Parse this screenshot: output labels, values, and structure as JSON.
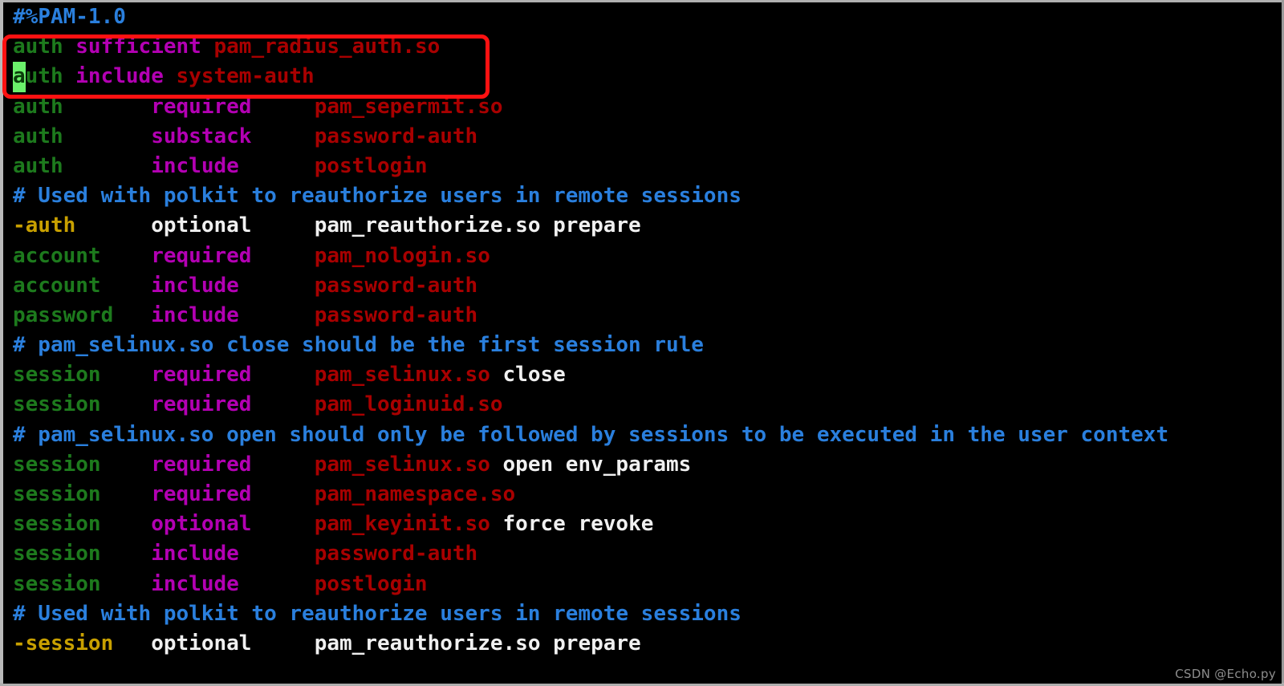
{
  "app": {
    "title": "PAM configuration file (/etc/pam.d/sshd) open in terminal editor",
    "background_color": "#000000"
  },
  "colors": {
    "comment": "#2a7fdd",
    "type": "#1d7a1d",
    "negated_type": "#c8a000",
    "control_flag": "#b300b3",
    "module": "#a80000",
    "argument": "#f0f0f0",
    "cursor_background": "#6bf06b",
    "cursor_foreground": "#0b3d0b",
    "annotation_rectangle": "#ff1111"
  },
  "cursor": {
    "character": "a",
    "line_index": 2,
    "column": 1
  },
  "annotation": {
    "shape": "rectangle",
    "color": "#ff1111",
    "covers_lines": [
      "auth sufficient pam_radius_auth.so",
      "auth include system-auth"
    ]
  },
  "watermark": {
    "text": "CSDN @Echo.py"
  },
  "lines": [
    {
      "id": "line-1",
      "tokens": [
        {
          "text": "#%PAM-1.0",
          "kind": "comment"
        }
      ]
    },
    {
      "id": "line-2",
      "tokens": [
        {
          "text": "auth",
          "kind": "type"
        },
        {
          "text": " ",
          "kind": "plain"
        },
        {
          "text": "sufficient",
          "kind": "ctrl"
        },
        {
          "text": " ",
          "kind": "plain"
        },
        {
          "text": "pam_radius_auth.so",
          "kind": "module"
        }
      ]
    },
    {
      "id": "line-3",
      "tokens": [
        {
          "text": "a",
          "kind": "cursor"
        },
        {
          "text": "uth",
          "kind": "type"
        },
        {
          "text": " ",
          "kind": "plain"
        },
        {
          "text": "include",
          "kind": "ctrl"
        },
        {
          "text": " ",
          "kind": "plain"
        },
        {
          "text": "system-auth",
          "kind": "module"
        }
      ]
    },
    {
      "id": "line-4",
      "tokens": [
        {
          "text": "auth",
          "kind": "type"
        },
        {
          "text": "       ",
          "kind": "plain"
        },
        {
          "text": "required",
          "kind": "ctrl"
        },
        {
          "text": "     ",
          "kind": "plain"
        },
        {
          "text": "pam_sepermit.so",
          "kind": "module"
        }
      ]
    },
    {
      "id": "line-5",
      "tokens": [
        {
          "text": "auth",
          "kind": "type"
        },
        {
          "text": "       ",
          "kind": "plain"
        },
        {
          "text": "substack",
          "kind": "ctrl"
        },
        {
          "text": "     ",
          "kind": "plain"
        },
        {
          "text": "password-auth",
          "kind": "module"
        }
      ]
    },
    {
      "id": "line-6",
      "tokens": [
        {
          "text": "auth",
          "kind": "type"
        },
        {
          "text": "       ",
          "kind": "plain"
        },
        {
          "text": "include",
          "kind": "ctrl"
        },
        {
          "text": "      ",
          "kind": "plain"
        },
        {
          "text": "postlogin",
          "kind": "module"
        }
      ]
    },
    {
      "id": "line-7",
      "tokens": [
        {
          "text": "# Used with polkit to reauthorize users in remote sessions",
          "kind": "comment"
        }
      ]
    },
    {
      "id": "line-8",
      "tokens": [
        {
          "text": "-auth",
          "kind": "neg"
        },
        {
          "text": "      ",
          "kind": "plain"
        },
        {
          "text": "optional",
          "kind": "arg"
        },
        {
          "text": "     ",
          "kind": "plain"
        },
        {
          "text": "pam_reauthorize.so prepare",
          "kind": "arg"
        }
      ]
    },
    {
      "id": "line-9",
      "tokens": [
        {
          "text": "account",
          "kind": "type"
        },
        {
          "text": "    ",
          "kind": "plain"
        },
        {
          "text": "required",
          "kind": "ctrl"
        },
        {
          "text": "     ",
          "kind": "plain"
        },
        {
          "text": "pam_nologin.so",
          "kind": "module"
        }
      ]
    },
    {
      "id": "line-10",
      "tokens": [
        {
          "text": "account",
          "kind": "type"
        },
        {
          "text": "    ",
          "kind": "plain"
        },
        {
          "text": "include",
          "kind": "ctrl"
        },
        {
          "text": "      ",
          "kind": "plain"
        },
        {
          "text": "password-auth",
          "kind": "module"
        }
      ]
    },
    {
      "id": "line-11",
      "tokens": [
        {
          "text": "password",
          "kind": "type"
        },
        {
          "text": "   ",
          "kind": "plain"
        },
        {
          "text": "include",
          "kind": "ctrl"
        },
        {
          "text": "      ",
          "kind": "plain"
        },
        {
          "text": "password-auth",
          "kind": "module"
        }
      ]
    },
    {
      "id": "line-12",
      "tokens": [
        {
          "text": "# pam_selinux.so close should be the first session rule",
          "kind": "comment"
        }
      ]
    },
    {
      "id": "line-13",
      "tokens": [
        {
          "text": "session",
          "kind": "type"
        },
        {
          "text": "    ",
          "kind": "plain"
        },
        {
          "text": "required",
          "kind": "ctrl"
        },
        {
          "text": "     ",
          "kind": "plain"
        },
        {
          "text": "pam_selinux.so",
          "kind": "module"
        },
        {
          "text": " ",
          "kind": "plain"
        },
        {
          "text": "close",
          "kind": "arg"
        }
      ]
    },
    {
      "id": "line-14",
      "tokens": [
        {
          "text": "session",
          "kind": "type"
        },
        {
          "text": "    ",
          "kind": "plain"
        },
        {
          "text": "required",
          "kind": "ctrl"
        },
        {
          "text": "     ",
          "kind": "plain"
        },
        {
          "text": "pam_loginuid.so",
          "kind": "module"
        }
      ]
    },
    {
      "id": "line-15",
      "tokens": [
        {
          "text": "# pam_selinux.so open should only be followed by sessions to be executed in the user context",
          "kind": "comment"
        }
      ]
    },
    {
      "id": "line-16",
      "tokens": [
        {
          "text": "session",
          "kind": "type"
        },
        {
          "text": "    ",
          "kind": "plain"
        },
        {
          "text": "required",
          "kind": "ctrl"
        },
        {
          "text": "     ",
          "kind": "plain"
        },
        {
          "text": "pam_selinux.so",
          "kind": "module"
        },
        {
          "text": " ",
          "kind": "plain"
        },
        {
          "text": "open env_params",
          "kind": "arg"
        }
      ]
    },
    {
      "id": "line-17",
      "tokens": [
        {
          "text": "session",
          "kind": "type"
        },
        {
          "text": "    ",
          "kind": "plain"
        },
        {
          "text": "required",
          "kind": "ctrl"
        },
        {
          "text": "     ",
          "kind": "plain"
        },
        {
          "text": "pam_namespace.so",
          "kind": "module"
        }
      ]
    },
    {
      "id": "line-18",
      "tokens": [
        {
          "text": "session",
          "kind": "type"
        },
        {
          "text": "    ",
          "kind": "plain"
        },
        {
          "text": "optional",
          "kind": "ctrl"
        },
        {
          "text": "     ",
          "kind": "plain"
        },
        {
          "text": "pam_keyinit.so",
          "kind": "module"
        },
        {
          "text": " ",
          "kind": "plain"
        },
        {
          "text": "force revoke",
          "kind": "arg"
        }
      ]
    },
    {
      "id": "line-19",
      "tokens": [
        {
          "text": "session",
          "kind": "type"
        },
        {
          "text": "    ",
          "kind": "plain"
        },
        {
          "text": "include",
          "kind": "ctrl"
        },
        {
          "text": "      ",
          "kind": "plain"
        },
        {
          "text": "password-auth",
          "kind": "module"
        }
      ]
    },
    {
      "id": "line-20",
      "tokens": [
        {
          "text": "session",
          "kind": "type"
        },
        {
          "text": "    ",
          "kind": "plain"
        },
        {
          "text": "include",
          "kind": "ctrl"
        },
        {
          "text": "      ",
          "kind": "plain"
        },
        {
          "text": "postlogin",
          "kind": "module"
        }
      ]
    },
    {
      "id": "line-21",
      "tokens": [
        {
          "text": "# Used with polkit to reauthorize users in remote sessions",
          "kind": "comment"
        }
      ]
    },
    {
      "id": "line-22",
      "tokens": [
        {
          "text": "-session",
          "kind": "neg"
        },
        {
          "text": "   ",
          "kind": "plain"
        },
        {
          "text": "optional",
          "kind": "arg"
        },
        {
          "text": "     ",
          "kind": "plain"
        },
        {
          "text": "pam_reauthorize.so prepare",
          "kind": "arg"
        }
      ]
    }
  ]
}
